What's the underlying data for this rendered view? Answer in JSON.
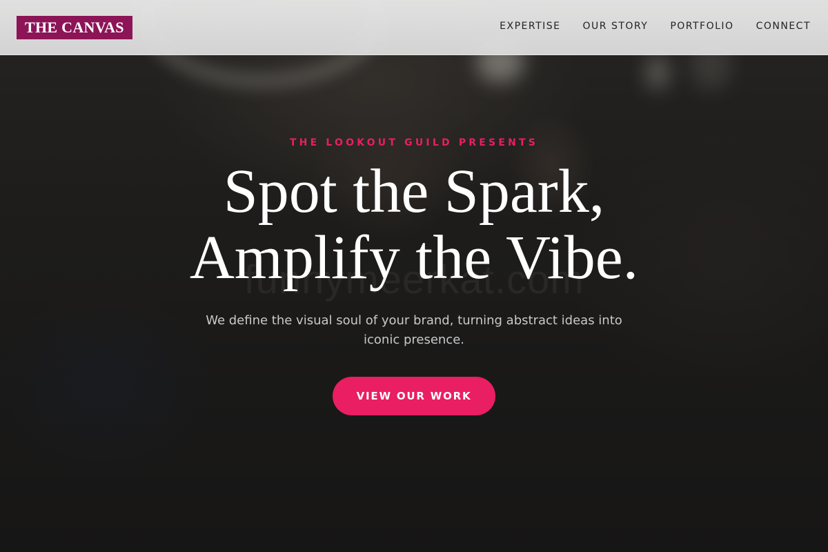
{
  "header": {
    "logo_text": "THE CANVAS",
    "nav": [
      {
        "label": "EXPERTISE"
      },
      {
        "label": "OUR STORY"
      },
      {
        "label": "PORTFOLIO"
      },
      {
        "label": "CONNECT"
      }
    ]
  },
  "hero": {
    "eyebrow": "THE LOOKOUT GUILD PRESENTS",
    "headline_line1": "Spot the Spark,",
    "headline_line2": "Amplify the Vibe.",
    "subtitle": "We define the visual soul of your brand, turning abstract ideas into iconic presence.",
    "cta_label": "VIEW OUR WORK",
    "watermark": "funnymeerkat.com"
  },
  "colors": {
    "brand": "#8c1457",
    "accent": "#e91e63",
    "header_bg": "#e4e4e4",
    "hero_bg": "#1b1a1a"
  }
}
